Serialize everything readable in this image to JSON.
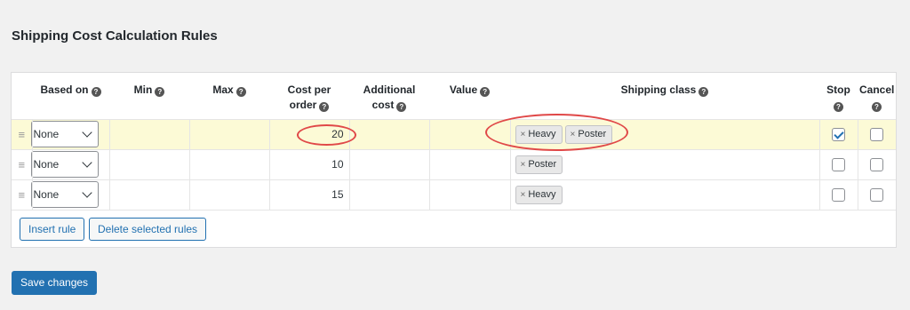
{
  "page_title": "Shipping Cost Calculation Rules",
  "columns": {
    "based_on": "Based on",
    "min": "Min",
    "max": "Max",
    "cost_per_order": "Cost per order",
    "additional_cost": "Additional cost",
    "value": "Value",
    "shipping_class": "Shipping class",
    "stop": "Stop",
    "cancel": "Cancel"
  },
  "help_glyph": "?",
  "drag_glyph": "≡",
  "tag_remove_glyph": "×",
  "rows": [
    {
      "based_on": "None",
      "min": "",
      "max": "",
      "cost_per_order": "20",
      "additional_cost": "",
      "value": "",
      "shipping_classes": [
        "Heavy",
        "Poster"
      ],
      "stop": true,
      "cancel": false,
      "highlighted": true
    },
    {
      "based_on": "None",
      "min": "",
      "max": "",
      "cost_per_order": "10",
      "additional_cost": "",
      "value": "",
      "shipping_classes": [
        "Poster"
      ],
      "stop": false,
      "cancel": false,
      "highlighted": false
    },
    {
      "based_on": "None",
      "min": "",
      "max": "",
      "cost_per_order": "15",
      "additional_cost": "",
      "value": "",
      "shipping_classes": [
        "Heavy"
      ],
      "stop": false,
      "cancel": false,
      "highlighted": false
    }
  ],
  "buttons": {
    "insert_rule": "Insert rule",
    "delete_selected_rules": "Delete selected rules",
    "save_changes": "Save changes"
  },
  "colors": {
    "accent": "#2271b1",
    "highlight_row": "#fcfad6",
    "annotation": "#e04848"
  }
}
